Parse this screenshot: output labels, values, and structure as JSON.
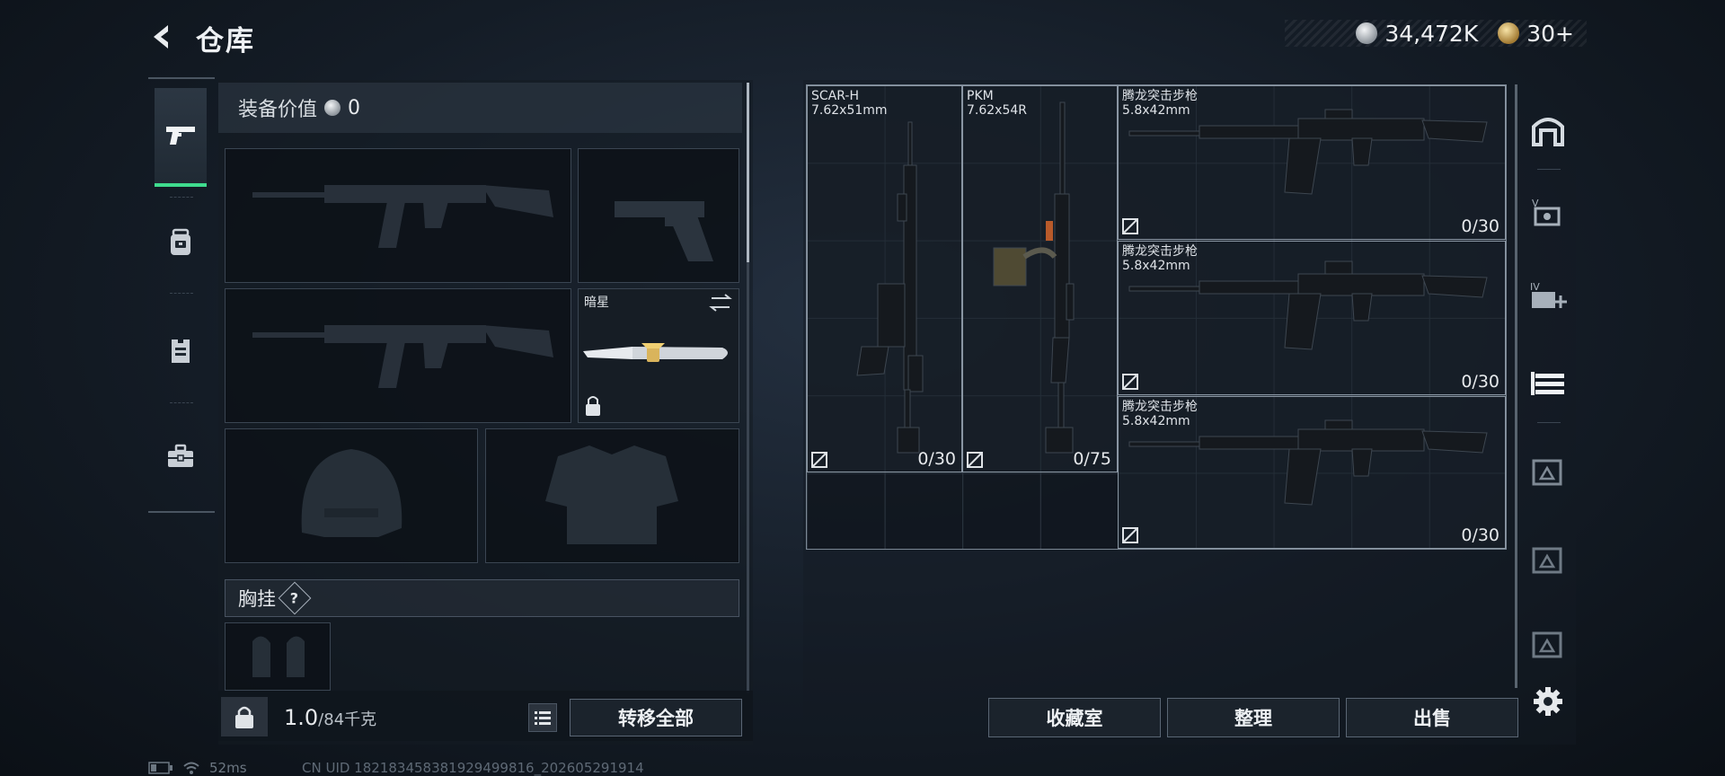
{
  "header": {
    "title": "仓库",
    "currencies": [
      {
        "icon": "silver-coin-icon",
        "value": "34,472K"
      },
      {
        "icon": "gold-coin-icon",
        "value": "30+"
      }
    ]
  },
  "left_nav": [
    {
      "name": "weapons",
      "icon": "pistol-icon",
      "active": true
    },
    {
      "name": "backpack",
      "icon": "backpack-icon",
      "active": false
    },
    {
      "name": "vest",
      "icon": "vest-icon",
      "active": false
    },
    {
      "name": "toolbox",
      "icon": "briefcase-icon",
      "active": false
    }
  ],
  "loadout": {
    "equip_value_label": "装备价值",
    "equip_value": "0",
    "slots": {
      "primary_1": "",
      "secondary_pistol": "",
      "primary_2": "",
      "melee": {
        "name": "暗星",
        "locked": true
      },
      "helmet": "",
      "armor": ""
    },
    "chest_rig_label": "胸挂",
    "chest_rig_help": "?",
    "weight_current": "1.0",
    "weight_capacity": "/84千克",
    "transfer_all_label": "转移全部"
  },
  "stash": {
    "items": [
      {
        "name": "SCAR-H",
        "caliber": "7.62x51mm",
        "ammo": "0/30"
      },
      {
        "name": "PKM",
        "caliber": "7.62x54R",
        "ammo": "0/75"
      },
      {
        "name": "腾龙突击步枪",
        "caliber": "5.8x42mm",
        "ammo": "0/30"
      },
      {
        "name": "腾龙突击步枪",
        "caliber": "5.8x42mm",
        "ammo": "0/30"
      },
      {
        "name": "腾龙突击步枪",
        "caliber": "5.8x42mm",
        "ammo": "0/30"
      }
    ],
    "buttons": {
      "collection": "收藏室",
      "sort": "整理",
      "sell": "出售"
    },
    "side_tools": [
      "stash-icon",
      "v-case-icon",
      "iv-case-plus-icon",
      "weapon-rack-icon",
      "case-icon-1",
      "case-icon-2",
      "case-icon-3"
    ]
  },
  "status_bar": {
    "ping": "52ms",
    "uid": "CN UID 182183458381929499816_202605291914"
  },
  "colors": {
    "accent_green": "#3fdc8e",
    "border": "#8a96a3"
  }
}
